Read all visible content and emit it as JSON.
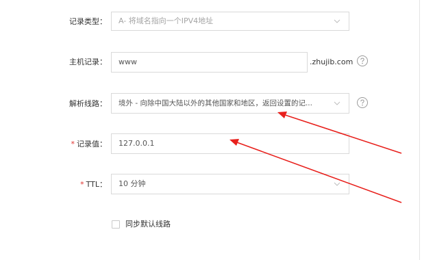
{
  "form": {
    "record_type": {
      "label": "记录类型",
      "colon": "：",
      "value": "A- 将域名指向一个IPV4地址"
    },
    "host": {
      "label": "主机记录",
      "colon": "：",
      "value": "www",
      "suffix": ".zhujib.com"
    },
    "line": {
      "label": "解析线路",
      "colon": "：",
      "value": "境外 - 向除中国大陆以外的其他国家和地区，返回设置的记..."
    },
    "value": {
      "required_mark": "*",
      "label": "记录值",
      "colon": "：",
      "value": "127.0.0.1"
    },
    "ttl": {
      "required_mark": "*",
      "label": "TTL",
      "colon": "：",
      "value": "10 分钟"
    },
    "sync_default": {
      "label": "同步默认线路",
      "checked": false
    }
  },
  "colors": {
    "required": "#e0322f",
    "annotation_arrow": "#e8201c",
    "border": "#d9d9d9"
  },
  "icons": {
    "dropdown": "chevron-down-icon",
    "help": "question-circle-icon"
  }
}
